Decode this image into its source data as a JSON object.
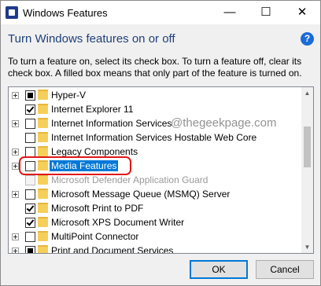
{
  "window": {
    "title": "Windows Features",
    "minimize_glyph": "—",
    "maximize_glyph": "☐",
    "close_glyph": "✕"
  },
  "header": {
    "title": "Turn Windows features on or off",
    "help_glyph": "?",
    "description": "To turn a feature on, select its check box. To turn a feature off, clear its check box. A filled box means that only part of the feature is turned on."
  },
  "watermark": "@thegeekpage.com",
  "features": [
    {
      "label": "Hyper-V",
      "state": "partial",
      "expandable": true
    },
    {
      "label": "Internet Explorer 11",
      "state": "checked",
      "expandable": false
    },
    {
      "label": "Internet Information Services",
      "state": "unchecked",
      "expandable": true
    },
    {
      "label": "Internet Information Services Hostable Web Core",
      "state": "unchecked",
      "expandable": false
    },
    {
      "label": "Legacy Components",
      "state": "unchecked",
      "expandable": true
    },
    {
      "label": "Media Features",
      "state": "unchecked",
      "expandable": true,
      "selected": true
    },
    {
      "label": "Microsoft Defender Application Guard",
      "state": "unchecked",
      "expandable": false,
      "disabled": true
    },
    {
      "label": "Microsoft Message Queue (MSMQ) Server",
      "state": "unchecked",
      "expandable": true
    },
    {
      "label": "Microsoft Print to PDF",
      "state": "checked",
      "expandable": false
    },
    {
      "label": "Microsoft XPS Document Writer",
      "state": "checked",
      "expandable": false
    },
    {
      "label": "MultiPoint Connector",
      "state": "unchecked",
      "expandable": true
    },
    {
      "label": "Print and Document Services",
      "state": "partial",
      "expandable": true
    }
  ],
  "buttons": {
    "ok": "OK",
    "cancel": "Cancel"
  },
  "colors": {
    "header_title": "#1f3f78",
    "selection": "#0078d7",
    "highlight_border": "#e01818",
    "help_icon": "#1c6bd6"
  }
}
